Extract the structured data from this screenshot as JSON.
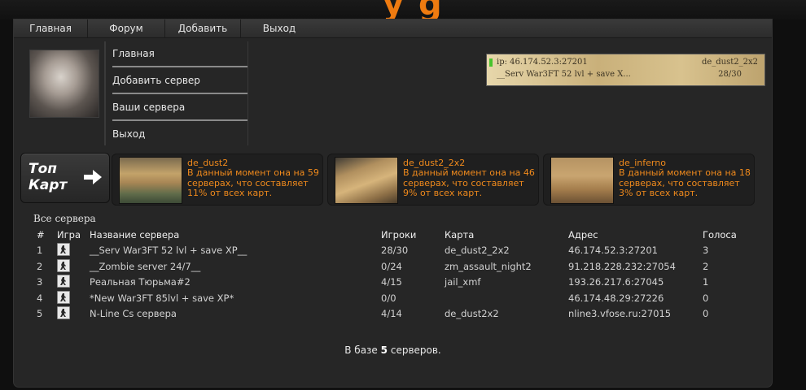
{
  "header": {
    "logo_fragment": "y   g"
  },
  "nav": {
    "items": [
      "Главная",
      "Форум",
      "Добавить",
      "Выход"
    ]
  },
  "user_menu": {
    "items": [
      "Главная",
      "Добавить сервер",
      "Ваши сервера",
      "Выход"
    ]
  },
  "banner": {
    "ip": "ip: 46.174.52.3:27201",
    "map": "de_dust2_2x2",
    "name": "__Serv War3FT 52 lvl + save X...",
    "players": "28/30"
  },
  "top_maps": {
    "label_line1": "Топ",
    "label_line2": "Карт",
    "cards": [
      {
        "name": "de_dust2",
        "desc": "В данный момент она на 59 серверах, что составляет 11% от всех карт."
      },
      {
        "name": "de_dust2_2x2",
        "desc": "В данный момент она на 46 серверах, что составляет 9% от всех карт."
      },
      {
        "name": "de_inferno",
        "desc": "В данный момент она на 18 серверах, что составляет 3% от всех карт."
      }
    ]
  },
  "servers": {
    "title": "Все сервера",
    "headers": {
      "num": "#",
      "game": "Игра",
      "name": "Название сервера",
      "players": "Игроки",
      "map": "Карта",
      "address": "Адрес",
      "votes": "Голоса"
    },
    "rows": [
      {
        "num": "1",
        "name": "__Serv War3FT 52 lvl + save XP__",
        "players": "28/30",
        "map": "de_dust2_2x2",
        "address": "46.174.52.3:27201",
        "votes": "3"
      },
      {
        "num": "2",
        "name": "__Zombie server 24/7__",
        "players": "0/24",
        "map": "zm_assault_night2",
        "address": "91.218.228.232:27054",
        "votes": "2"
      },
      {
        "num": "3",
        "name": "Реальная Тюрьма#2",
        "players": "4/15",
        "map": "jail_xmf",
        "address": "193.26.217.6:27045",
        "votes": "1"
      },
      {
        "num": "4",
        "name": "*New War3FT 85lvl + save XP*",
        "players": "0/0",
        "map": "",
        "address": "46.174.48.29:27226",
        "votes": "0"
      },
      {
        "num": "5",
        "name": "N-Line Cs сервера",
        "players": "4/14",
        "map": "de_dust2x2",
        "address": "nline3.vfose.ru:27015",
        "votes": "0"
      }
    ],
    "total_prefix": "В базе",
    "total_count": "5",
    "total_suffix": "серверов."
  },
  "colors": {
    "accent": "#f08a1c",
    "background": "#262626",
    "status_online": "#49c32c"
  },
  "icons": [
    "arrow-right-icon",
    "counter-strike-game-icon"
  ]
}
